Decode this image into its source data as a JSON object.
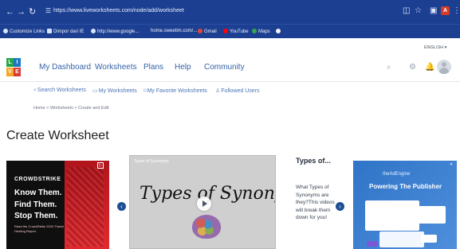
{
  "browser": {
    "url": "https://www.liveworksheets.com/node/add/worksheet",
    "bookmarks": [
      {
        "label": "Customize Links"
      },
      {
        "label": "Dimpor dari IE"
      },
      {
        "label": "http://www.google..."
      },
      {
        "label": "home.sweetim.com/..."
      },
      {
        "label": "Gmail"
      },
      {
        "label": "YouTube"
      },
      {
        "label": "Maps"
      }
    ],
    "profile_initial": "A"
  },
  "site": {
    "language": "ENGLISH ▾",
    "nav": [
      "My Dashboard",
      "Worksheets",
      "Plans",
      "Help",
      "Community"
    ],
    "subnav": [
      "Search Worksheets",
      "My Worksheets",
      "My Favorite Worksheets",
      "Followed Users"
    ],
    "breadcrumb": [
      "Home",
      "Worksheets",
      "Create and Edit"
    ],
    "page_title": "Create Worksheet"
  },
  "ads": {
    "left": {
      "brand": "CROWDSTRIKE",
      "lines": [
        "Know Them.",
        "Find Them.",
        "Stop Them."
      ],
      "small": "Read the CrowdStrike 2024 Threat Hunting Report"
    },
    "right": {
      "brand": "theAdEngine",
      "headline": "Powering The Publisher"
    }
  },
  "video": {
    "caption": "Types of Synonyms",
    "title_art": "Types of Synonyms"
  },
  "description": {
    "title": "Types of...",
    "body": "What Types of Synonyms are they?This videos will break them down for you!"
  }
}
